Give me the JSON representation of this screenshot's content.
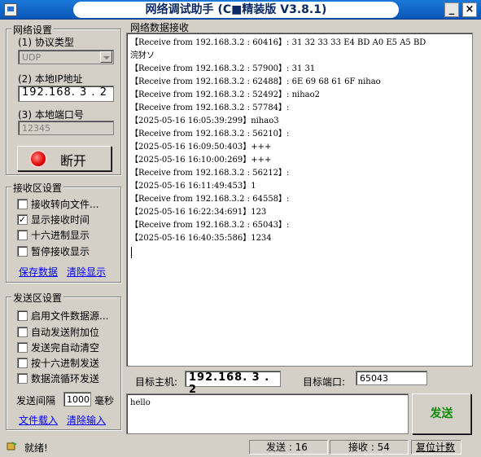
{
  "window": {
    "title": "网络调试助手 (C■精装版 V3.8.1)",
    "min_label": "_",
    "close_label": "×"
  },
  "net_settings": {
    "group_title": "网络设置",
    "protocol_label": "(1) 协议类型",
    "protocol_value": "UDP",
    "local_ip_label": "(2) 本地IP地址",
    "local_ip_value": "192.168. 3 . 2",
    "local_port_label": "(3) 本地端口号",
    "local_port_value": "12345",
    "disconnect_label": "断开"
  },
  "recv_settings": {
    "group_title": "接收区设置",
    "options": [
      {
        "label": "接收转向文件...",
        "checked": false
      },
      {
        "label": "显示接收时间",
        "checked": true
      },
      {
        "label": "十六进制显示",
        "checked": false
      },
      {
        "label": "暂停接收显示",
        "checked": false
      }
    ],
    "save_link": "保存数据",
    "clear_link": "清除显示"
  },
  "send_settings": {
    "group_title": "发送区设置",
    "options": [
      {
        "label": "启用文件数据源...",
        "checked": false
      },
      {
        "label": "自动发送附加位",
        "checked": false
      },
      {
        "label": "发送完自动清空",
        "checked": false
      },
      {
        "label": "按十六进制发送",
        "checked": false
      },
      {
        "label": "数据流循环发送",
        "checked": false
      }
    ],
    "interval_label": "发送间隔",
    "interval_value": "1000",
    "interval_unit": "毫秒",
    "load_file_link": "文件载入",
    "clear_input_link": "清除输入"
  },
  "receive": {
    "title": "网络数据接收",
    "lines": [
      "【Receive from 192.168.3.2 : 60416】: 31 32 33 33 E4 BD A0 E5 A5 BD",
      "浣犲ソ",
      "【Receive from 192.168.3.2 : 57900】: 31 31",
      "【Receive from 192.168.3.2 : 62488】: 6E 69 68 61 6F nihao",
      "【Receive from 192.168.3.2 : 52492】: nihao2",
      "【Receive from 192.168.3.2 : 57784】:",
      "【2025-05-16 16:05:39:299】nihao3",
      "【Receive from 192.168.3.2 : 56210】:",
      "【2025-05-16 16:09:50:403】+++",
      "【2025-05-16 16:10:00:269】+++",
      "【Receive from 192.168.3.2 : 56212】:",
      "【2025-05-16 16:11:49:453】1",
      "【Receive from 192.168.3.2 : 64558】:",
      "【2025-05-16 16:22:34:691】123",
      "【Receive from 192.168.3.2 : 65043】:",
      "【2025-05-16 16:40:35:586】1234"
    ]
  },
  "target": {
    "host_label": "目标主机:",
    "host_value": "192.168. 3 . 2",
    "port_label": "目标端口:",
    "port_value": "65043"
  },
  "send": {
    "text": "hello",
    "button_label": "发送"
  },
  "status": {
    "ready": "就绪!",
    "sent": "发送 : 16",
    "received": "接收 : 54",
    "reset": "复位计数"
  }
}
